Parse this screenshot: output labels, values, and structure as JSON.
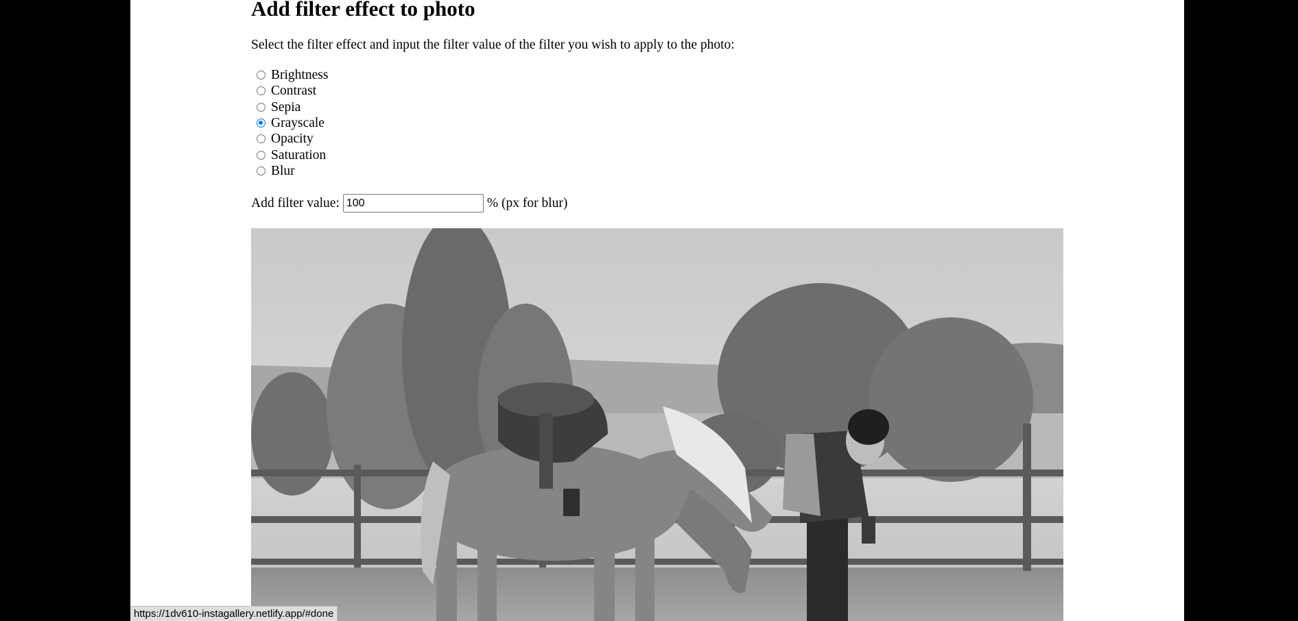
{
  "heading": "Add filter effect to photo",
  "instruction": "Select the filter effect and input the filter value of the filter you wish to apply to the photo:",
  "filters": [
    {
      "label": "Brightness",
      "checked": false
    },
    {
      "label": "Contrast",
      "checked": false
    },
    {
      "label": "Sepia",
      "checked": false
    },
    {
      "label": "Grayscale",
      "checked": true
    },
    {
      "label": "Opacity",
      "checked": false
    },
    {
      "label": "Saturation",
      "checked": false
    },
    {
      "label": "Blur",
      "checked": false
    }
  ],
  "filter_value": {
    "label": "Add filter value:",
    "value": "100",
    "unit_note": "% (px for blur)"
  },
  "status_bar": {
    "url": "https://1dv610-instagallery.netlify.app/#done"
  },
  "colors": {
    "radio_accent": "#0075ff",
    "page_background": "#ffffff",
    "side_background": "#000000"
  }
}
